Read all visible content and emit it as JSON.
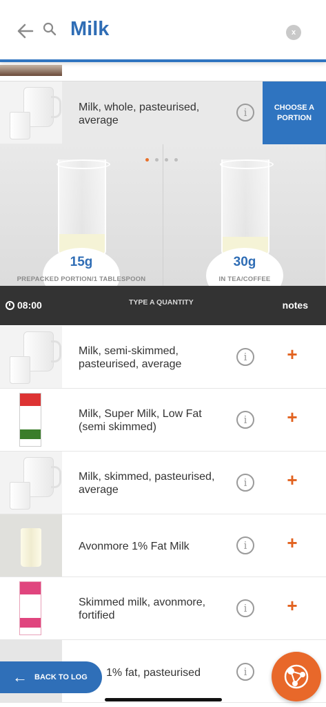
{
  "search": {
    "query": "Milk",
    "clear_label": "x"
  },
  "selected": {
    "title": "Milk, whole, pasteurised, average",
    "info_label": "i",
    "choose_portion_label": "CHOOSE A PORTION"
  },
  "portions": [
    {
      "amount": "15g",
      "label": "PREPACKED PORTION/1 TABLESPOON"
    },
    {
      "amount": "30g",
      "label": "IN TEA/COFFEE"
    }
  ],
  "carousel": {
    "page_count": 4,
    "active_index": 0
  },
  "bar": {
    "time": "08:00",
    "type_quantity": "TYPE A QUANTITY",
    "notes": "notes"
  },
  "results": [
    {
      "title": "Milk, semi-skimmed, pasteurised, average",
      "image": "jug"
    },
    {
      "title": "Milk, Super Milk, Low Fat (semi skimmed)",
      "image": "carton-red"
    },
    {
      "title": "Milk, skimmed, pasteurised, average",
      "image": "jug"
    },
    {
      "title": "Avonmore 1% Fat Milk",
      "image": "glass"
    },
    {
      "title": "Skimmed milk, avonmore, fortified",
      "image": "carton-pink"
    },
    {
      "title": "1% fat, pasteurised",
      "image": "partial"
    }
  ],
  "icons": {
    "info": "i",
    "plus": "+"
  },
  "footer": {
    "back_to_log": "BACK TO LOG",
    "back_arrow": "←"
  },
  "colors": {
    "brand_blue": "#2f74c0",
    "accent_orange": "#e2621f",
    "dark_bar": "#333333"
  }
}
